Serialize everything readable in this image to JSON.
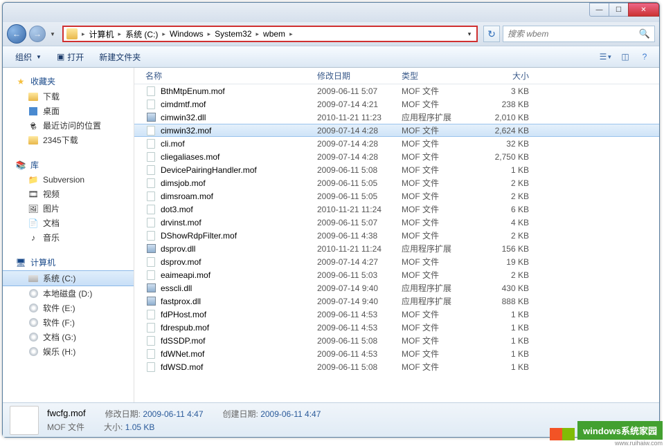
{
  "titlebar": {
    "min": "—",
    "max": "☐",
    "close": "✕"
  },
  "nav": {
    "back": "←",
    "fwd": "→",
    "dd": "▼",
    "refresh": "↻"
  },
  "breadcrumb": [
    "计算机",
    "系统 (C:)",
    "Windows",
    "System32",
    "wbem"
  ],
  "search": {
    "placeholder": "搜索 wbem"
  },
  "toolbar": {
    "organize": "组织",
    "open": "打开",
    "newfolder": "新建文件夹"
  },
  "sidebar": {
    "favorites": {
      "label": "收藏夹",
      "items": [
        "下载",
        "桌面",
        "最近访问的位置",
        "2345下载"
      ]
    },
    "libraries": {
      "label": "库",
      "items": [
        "Subversion",
        "视频",
        "图片",
        "文档",
        "音乐"
      ]
    },
    "computer": {
      "label": "计算机",
      "items": [
        "系统 (C:)",
        "本地磁盘 (D:)",
        "软件 (E:)",
        "软件 (F:)",
        "文档 (G:)",
        "娱乐 (H:)"
      ]
    }
  },
  "columns": {
    "name": "名称",
    "date": "修改日期",
    "type": "类型",
    "size": "大小"
  },
  "files": [
    {
      "n": "BthMtpEnum.mof",
      "d": "2009-06-11 5:07",
      "t": "MOF 文件",
      "s": "3 KB",
      "k": "f"
    },
    {
      "n": "cimdmtf.mof",
      "d": "2009-07-14 4:21",
      "t": "MOF 文件",
      "s": "238 KB",
      "k": "f"
    },
    {
      "n": "cimwin32.dll",
      "d": "2010-11-21 11:23",
      "t": "应用程序扩展",
      "s": "2,010 KB",
      "k": "d"
    },
    {
      "n": "cimwin32.mof",
      "d": "2009-07-14 4:28",
      "t": "MOF 文件",
      "s": "2,624 KB",
      "k": "f",
      "sel": true
    },
    {
      "n": "cli.mof",
      "d": "2009-07-14 4:28",
      "t": "MOF 文件",
      "s": "32 KB",
      "k": "f"
    },
    {
      "n": "cliegaliases.mof",
      "d": "2009-07-14 4:28",
      "t": "MOF 文件",
      "s": "2,750 KB",
      "k": "f"
    },
    {
      "n": "DevicePairingHandler.mof",
      "d": "2009-06-11 5:08",
      "t": "MOF 文件",
      "s": "1 KB",
      "k": "f"
    },
    {
      "n": "dimsjob.mof",
      "d": "2009-06-11 5:05",
      "t": "MOF 文件",
      "s": "2 KB",
      "k": "f"
    },
    {
      "n": "dimsroam.mof",
      "d": "2009-06-11 5:05",
      "t": "MOF 文件",
      "s": "2 KB",
      "k": "f"
    },
    {
      "n": "dot3.mof",
      "d": "2010-11-21 11:24",
      "t": "MOF 文件",
      "s": "6 KB",
      "k": "f"
    },
    {
      "n": "drvinst.mof",
      "d": "2009-06-11 5:07",
      "t": "MOF 文件",
      "s": "4 KB",
      "k": "f"
    },
    {
      "n": "DShowRdpFilter.mof",
      "d": "2009-06-11 4:38",
      "t": "MOF 文件",
      "s": "2 KB",
      "k": "f"
    },
    {
      "n": "dsprov.dll",
      "d": "2010-11-21 11:24",
      "t": "应用程序扩展",
      "s": "156 KB",
      "k": "d"
    },
    {
      "n": "dsprov.mof",
      "d": "2009-07-14 4:27",
      "t": "MOF 文件",
      "s": "19 KB",
      "k": "f"
    },
    {
      "n": "eaimeapi.mof",
      "d": "2009-06-11 5:03",
      "t": "MOF 文件",
      "s": "2 KB",
      "k": "f"
    },
    {
      "n": "esscli.dll",
      "d": "2009-07-14 9:40",
      "t": "应用程序扩展",
      "s": "430 KB",
      "k": "d"
    },
    {
      "n": "fastprox.dll",
      "d": "2009-07-14 9:40",
      "t": "应用程序扩展",
      "s": "888 KB",
      "k": "d"
    },
    {
      "n": "fdPHost.mof",
      "d": "2009-06-11 4:53",
      "t": "MOF 文件",
      "s": "1 KB",
      "k": "f"
    },
    {
      "n": "fdrespub.mof",
      "d": "2009-06-11 4:53",
      "t": "MOF 文件",
      "s": "1 KB",
      "k": "f"
    },
    {
      "n": "fdSSDP.mof",
      "d": "2009-06-11 5:08",
      "t": "MOF 文件",
      "s": "1 KB",
      "k": "f"
    },
    {
      "n": "fdWNet.mof",
      "d": "2009-06-11 4:53",
      "t": "MOF 文件",
      "s": "1 KB",
      "k": "f"
    },
    {
      "n": "fdWSD.mof",
      "d": "2009-06-11 5:08",
      "t": "MOF 文件",
      "s": "1 KB",
      "k": "f"
    }
  ],
  "details": {
    "filename": "fwcfg.mof",
    "modlabel": "修改日期:",
    "moddate": "2009-06-11 4:47",
    "crelabel": "创建日期:",
    "credate": "2009-06-11 4:47",
    "typelabel": "MOF 文件",
    "sizelabel": "大小:",
    "sizeval": "1.05 KB"
  },
  "watermark": {
    "text": "windows系统家园",
    "sub": "www.ruihaiw.com"
  }
}
